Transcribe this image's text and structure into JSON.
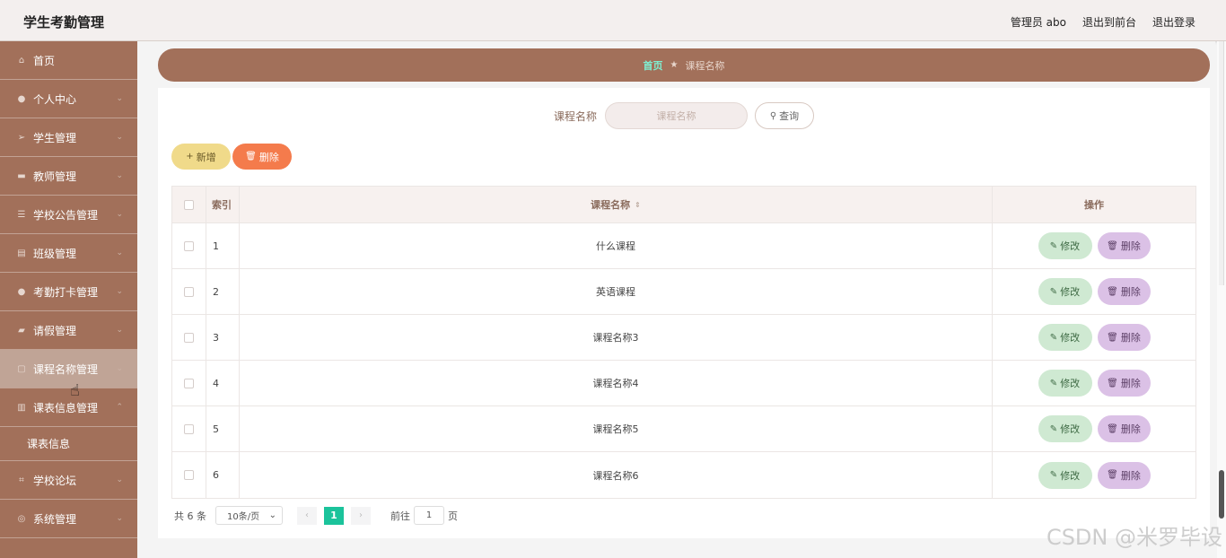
{
  "header": {
    "title": "学生考勤管理",
    "user": "管理员 abo",
    "to_front": "退出到前台",
    "logout": "退出登录"
  },
  "sidebar": {
    "items": [
      {
        "label": "首页",
        "icon": "home-icon"
      },
      {
        "label": "个人中心",
        "icon": "user-icon"
      },
      {
        "label": "学生管理",
        "icon": "send-icon"
      },
      {
        "label": "教师管理",
        "icon": "card-icon"
      },
      {
        "label": "学校公告管理",
        "icon": "sliders-icon"
      },
      {
        "label": "班级管理",
        "icon": "clipboard-icon"
      },
      {
        "label": "考勤打卡管理",
        "icon": "location-icon"
      },
      {
        "label": "请假管理",
        "icon": "briefcase-icon"
      },
      {
        "label": "课程名称管理",
        "icon": "chat-icon"
      },
      {
        "label": "课表信息管理",
        "icon": "chart-icon"
      }
    ],
    "sub_item": "课表信息",
    "items_after": [
      {
        "label": "学校论坛",
        "icon": "crop-icon"
      },
      {
        "label": "系统管理",
        "icon": "globe-icon"
      }
    ]
  },
  "breadcrumb": {
    "home": "首页",
    "current": "课程名称"
  },
  "search": {
    "label": "课程名称",
    "placeholder": "课程名称",
    "button": "查询"
  },
  "actions": {
    "add": "新增",
    "delete": "删除"
  },
  "table": {
    "headers": {
      "index": "索引",
      "name": "课程名称",
      "op": "操作"
    },
    "rows": [
      {
        "index": "1",
        "name": "什么课程"
      },
      {
        "index": "2",
        "name": "英语课程"
      },
      {
        "index": "3",
        "name": "课程名称3"
      },
      {
        "index": "4",
        "name": "课程名称4"
      },
      {
        "index": "5",
        "name": "课程名称5"
      },
      {
        "index": "6",
        "name": "课程名称6"
      }
    ],
    "edit_label": "修改",
    "delete_label": "删除"
  },
  "pager": {
    "total": "共 6 条",
    "page_size": "10条/页",
    "current_page": "1",
    "goto_prefix": "前往",
    "goto_value": "1",
    "goto_suffix": "页"
  },
  "watermark": "CSDN @米罗毕设"
}
